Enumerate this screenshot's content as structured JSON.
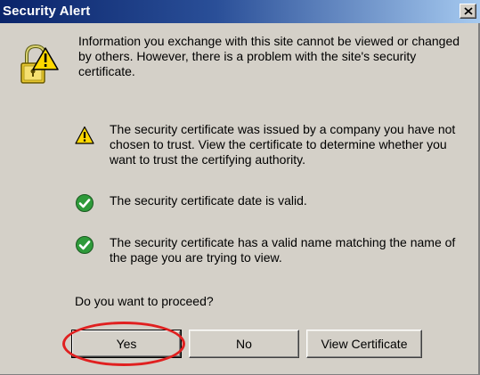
{
  "window": {
    "title": "Security Alert",
    "close_label": "close-icon"
  },
  "intro": {
    "text": "Information you exchange with this site cannot be viewed or changed by others. However, there is a problem with the site's security certificate."
  },
  "items": [
    {
      "icon": "warning-icon",
      "text": "The security certificate was issued by a company you have not chosen to trust. View the certificate to determine whether you want to trust the certifying authority."
    },
    {
      "icon": "check-icon",
      "text": "The security certificate date is valid."
    },
    {
      "icon": "check-icon",
      "text": "The security certificate has a valid name matching the name of the page you are trying to view."
    }
  ],
  "question": "Do you want to proceed?",
  "buttons": {
    "yes": "Yes",
    "no": "No",
    "view_certificate": "View Certificate"
  },
  "colors": {
    "titlebar_start": "#0a246a",
    "titlebar_end": "#a6caf0",
    "dialog_face": "#d4d0c8",
    "highlight": "#e02020",
    "check_green": "#2e9a3a",
    "warning_yellow": "#ffd800"
  }
}
